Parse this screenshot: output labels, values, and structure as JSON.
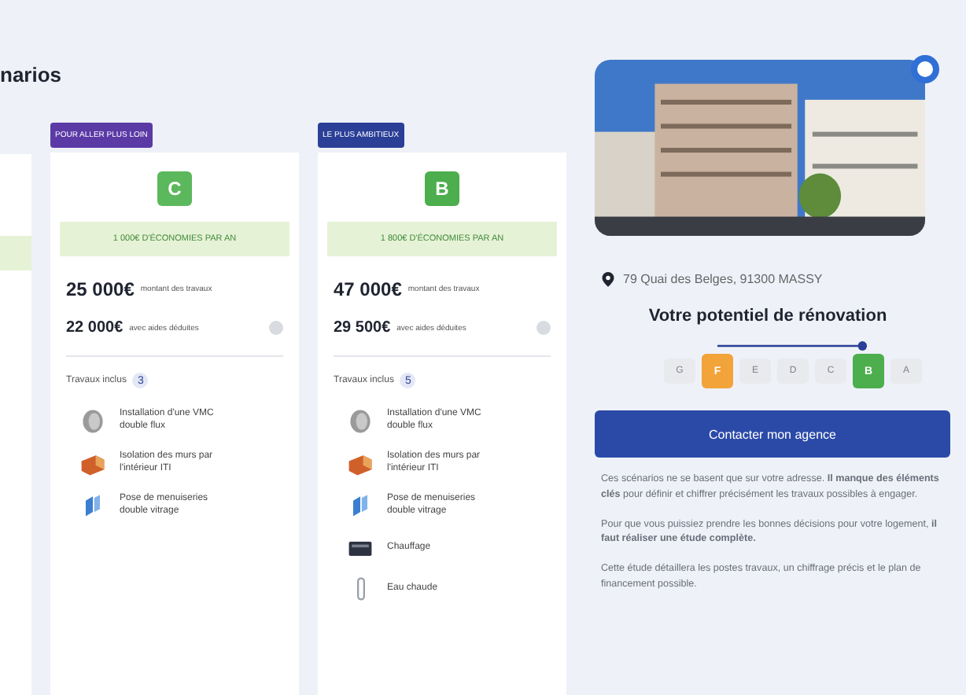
{
  "page_title": "narios",
  "scenarios": [
    {
      "tag": {
        "text": "POUR ALLER PLUS LOIN",
        "color": "#5b3aa6"
      },
      "grade": {
        "letter": "C",
        "color": "#5cb85c"
      },
      "savings": "1 000€ D'ÉCONOMIES PAR AN",
      "cost": "25 000€",
      "cost_label": "montant des travaux",
      "net": "22 000€",
      "net_label": "avec aides déduites",
      "works_label": "Travaux inclus",
      "works_count": "3",
      "works": [
        {
          "kind": "vmc",
          "label": "Installation d'une VMC double flux"
        },
        {
          "kind": "wall",
          "label": "Isolation des murs par l'intérieur ITI"
        },
        {
          "kind": "window",
          "label": "Pose de menuiseries double vitrage"
        }
      ]
    },
    {
      "tag": {
        "text": "LE PLUS AMBITIEUX",
        "color": "#2b3f97"
      },
      "grade": {
        "letter": "B",
        "color": "#4cae4c"
      },
      "savings": "1 800€ D'ÉCONOMIES PAR AN",
      "cost": "47 000€",
      "cost_label": "montant des travaux",
      "net": "29 500€",
      "net_label": "avec aides déduites",
      "works_label": "Travaux inclus",
      "works_count": "5",
      "works": [
        {
          "kind": "vmc",
          "label": "Installation d'une VMC double flux"
        },
        {
          "kind": "wall",
          "label": "Isolation des murs par l'intérieur ITI"
        },
        {
          "kind": "window",
          "label": "Pose de menuiseries double vitrage"
        },
        {
          "kind": "heater",
          "label": "Chauffage"
        },
        {
          "kind": "water",
          "label": "Eau chaude"
        }
      ]
    }
  ],
  "property": {
    "address": "79 Quai des Belges, 91300 MASSY",
    "potential_title": "Votre potentiel de rénovation",
    "scale": [
      {
        "label": "G",
        "selected": false,
        "color": "#e8eaee"
      },
      {
        "label": "F",
        "selected": true,
        "color": "#f2a33a"
      },
      {
        "label": "E",
        "selected": false,
        "color": "#e8eaee"
      },
      {
        "label": "D",
        "selected": false,
        "color": "#e8eaee"
      },
      {
        "label": "C",
        "selected": false,
        "color": "#e8eaee"
      },
      {
        "label": "B",
        "selected": true,
        "color": "#4cae4c"
      },
      {
        "label": "A",
        "selected": false,
        "color": "#e8eaee"
      }
    ],
    "contact_button": "Contacter mon agence",
    "paragraphs": [
      "Ces scénarios ne se basent que sur votre adresse. **Il manque des éléments clés** pour définir et chiffrer précisément les travaux possibles à engager.",
      "Pour que vous puissiez prendre les bonnes décisions pour votre logement, **il faut réaliser une étude complète.**",
      "Cette étude détaillera les postes travaux, un chiffrage précis et le plan de financement possible."
    ]
  }
}
